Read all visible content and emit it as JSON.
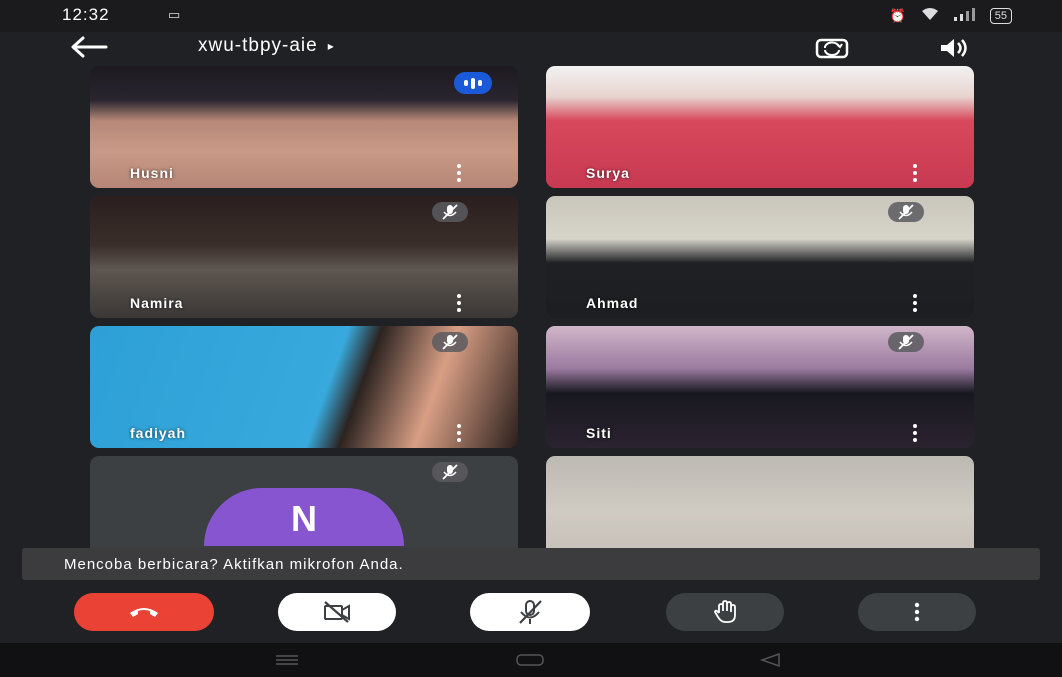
{
  "status_bar": {
    "time": "12:32",
    "battery": "55"
  },
  "header": {
    "meeting_code": "xwu-tbpy-aie",
    "caret": "▸"
  },
  "participants": [
    {
      "name": "Husni",
      "muted": false,
      "speaking": true
    },
    {
      "name": "Surya",
      "muted": false,
      "speaking": false
    },
    {
      "name": "Namira",
      "muted": true,
      "speaking": false
    },
    {
      "name": "Ahmad",
      "muted": true,
      "speaking": false
    },
    {
      "name": "fadiyah",
      "muted": true,
      "speaking": false
    },
    {
      "name": "Siti",
      "muted": true,
      "speaking": false
    },
    {
      "avatar_initial": "N",
      "avatar_color": "#8855d0",
      "muted": true
    },
    {
      "muted": false
    }
  ],
  "toast": {
    "message": "Mencoba berbicara? Aktifkan mikrofon Anda."
  },
  "controls": {
    "end_call_color": "#ea4335",
    "icons": [
      "end-call-icon",
      "camera-off-icon",
      "mic-off-icon",
      "raise-hand-icon",
      "more-vert-icon"
    ]
  },
  "colors": {
    "background": "#202124",
    "speaking_accent": "#1a5ad8",
    "avatar": "#8855d0"
  }
}
